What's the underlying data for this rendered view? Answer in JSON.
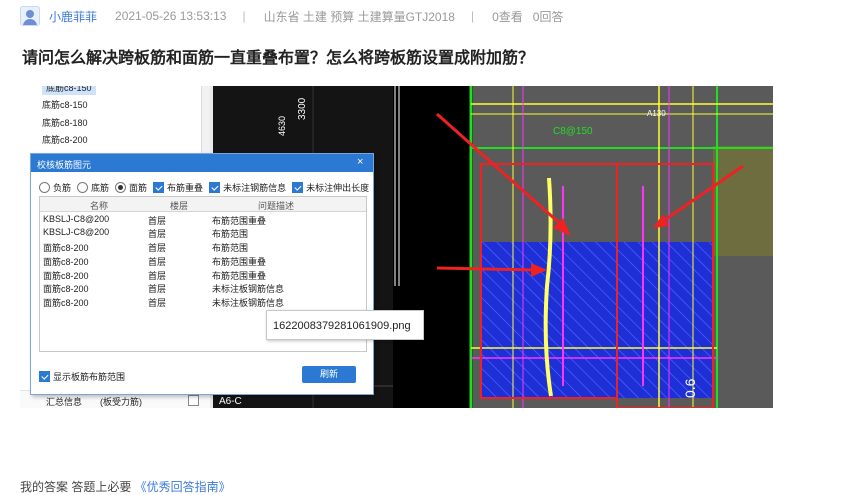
{
  "post": {
    "author": "小鹿菲菲",
    "datetime": "2021-05-26 13:53:13",
    "tags": "山东省  土建  预算  土建算量GTJ2018",
    "views": "0查看",
    "answers": "0回答",
    "sep": "|",
    "title": "请问怎么解决跨板筋和面筋一直重叠布置？怎么将跨板筋设置成附加筋？"
  },
  "tree": {
    "items": [
      "底筋c8-150",
      "底筋c8-150",
      "底筋c8-180",
      "底筋c8-200"
    ],
    "bottom_label": "汇总信息",
    "bottom_value": "(板受力筋)"
  },
  "dialog": {
    "title": "校核板筋图元",
    "radios": [
      {
        "label": "负筋",
        "checked": false
      },
      {
        "label": "底筋",
        "checked": false
      },
      {
        "label": "面筋",
        "checked": true
      }
    ],
    "checks": [
      "布筋重叠",
      "未标注钢筋信息",
      "未标注伸出长度"
    ],
    "columns": [
      "名称",
      "楼层",
      "问题描述"
    ],
    "rows": [
      {
        "name": "KBSLJ-C8@200",
        "floor": "首层",
        "issue": "布筋范围重叠"
      },
      {
        "name": "KBSLJ-C8@200",
        "floor": "首层",
        "issue": "布筋范围"
      },
      {
        "name": "面筋c8-200",
        "floor": "首层",
        "issue": "布筋范围"
      },
      {
        "name": "面筋c8-200",
        "floor": "首层",
        "issue": "布筋范围重叠"
      },
      {
        "name": "面筋c8-200",
        "floor": "首层",
        "issue": "布筋范围重叠"
      },
      {
        "name": "面筋c8-200",
        "floor": "首层",
        "issue": "未标注板钢筋信息"
      },
      {
        "name": "面筋c8-200",
        "floor": "首层",
        "issue": "未标注板钢筋信息"
      }
    ],
    "footer_check": "显示板筋布筋范围",
    "refresh": "刷新",
    "close": "×"
  },
  "tooltip": "1622008379281061909.png",
  "cad": {
    "labels": [
      "3300",
      "4630",
      "C8@150",
      "A130",
      "A6-C",
      "0.6"
    ],
    "colors": {
      "bg": "#000000",
      "gray": "#5a5a5a",
      "blue": "#1f2fd6",
      "green": "#22dd22",
      "yellow": "#ffff33",
      "magenta": "#ff33ff",
      "red": "#ee2222"
    }
  },
  "bottom": {
    "text": "我的答案    答题上必要    ",
    "link": "《优秀回答指南》"
  }
}
